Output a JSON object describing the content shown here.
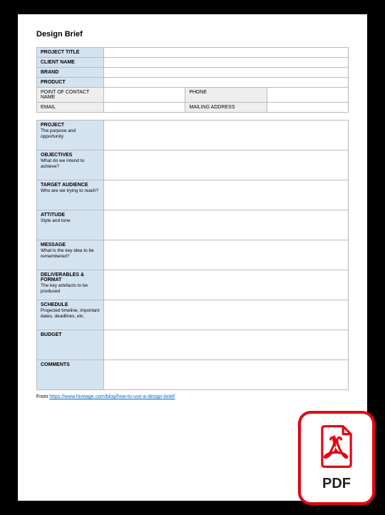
{
  "title": "Design Brief",
  "header_table": {
    "rows": [
      {
        "label": "PROJECT TITLE",
        "style": "blue"
      },
      {
        "label": "CLIENT NAME",
        "style": "blue"
      },
      {
        "label": "BRAND",
        "style": "blue"
      },
      {
        "label": "PRODUCT",
        "style": "blue"
      }
    ],
    "contact_row_1": {
      "left_label": "POINT OF CONTACT NAME",
      "right_label": "PHONE"
    },
    "contact_row_2": {
      "left_label": "EMAIL",
      "right_label": "MAILING ADDRESS"
    }
  },
  "sections": [
    {
      "label": "PROJECT",
      "sub": "The purpose and opportunity"
    },
    {
      "label": "OBJECTIVES",
      "sub": "What do we intend to achieve?"
    },
    {
      "label": "TARGET AUDIENCE",
      "sub": "Who are we trying to reach?"
    },
    {
      "label": "ATTITUDE",
      "sub": "Style and tone"
    },
    {
      "label": "MESSAGE",
      "sub": "What is the key idea to be remembered?"
    },
    {
      "label": "DELIVERABLES & FORMAT",
      "sub": "The key artefacts to be produced"
    },
    {
      "label": "SCHEDULE",
      "sub": "Projected timeline, important dates, deadlines, etc."
    },
    {
      "label": "BUDGET",
      "sub": ""
    },
    {
      "label": "COMMENTS",
      "sub": ""
    }
  ],
  "source": {
    "prefix": "From ",
    "link_text": "https://www.hiveage.com/blog/how-to-use-a-design-brief/"
  },
  "pdf_badge": {
    "label": "PDF"
  }
}
